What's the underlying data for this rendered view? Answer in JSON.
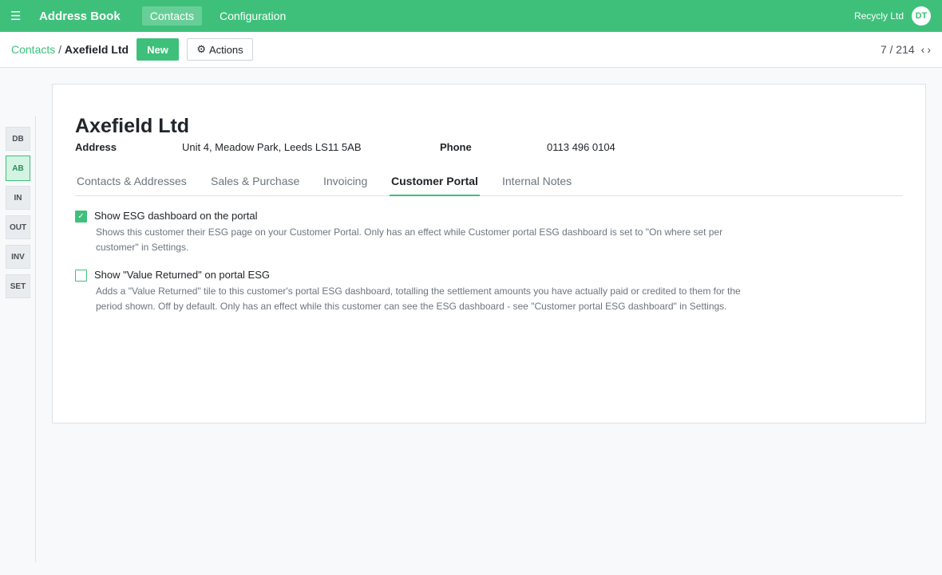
{
  "topbar": {
    "menu_icon": "☰",
    "app_title": "Address Book",
    "nav": [
      {
        "label": "Contacts"
      },
      {
        "label": "Configuration"
      }
    ],
    "company": "Recycly Ltd",
    "avatar_initials": "DT"
  },
  "control": {
    "breadcrumb_parent": "Contacts",
    "breadcrumb_sep": "/",
    "breadcrumb_current": "Axefield Ltd",
    "new_label": "New",
    "actions_icon": "⚙",
    "actions_label": "Actions",
    "pager": "7 / 214",
    "pager_prev": "‹",
    "pager_next": "›"
  },
  "siderail": [
    {
      "label": "DB"
    },
    {
      "label": "AB",
      "active": true
    },
    {
      "label": "IN"
    },
    {
      "label": "OUT"
    },
    {
      "label": "INV"
    },
    {
      "label": "SET"
    }
  ],
  "record": {
    "name": "Axefield Ltd",
    "address_label": "Address",
    "address_value": "Unit 4, Meadow Park, Leeds LS11 5AB",
    "phone_label": "Phone",
    "phone_value": "0113 496 0104"
  },
  "tabs": [
    {
      "label": "Contacts & Addresses"
    },
    {
      "label": "Sales & Purchase"
    },
    {
      "label": "Invoicing"
    },
    {
      "label": "Customer Portal",
      "active": true
    },
    {
      "label": "Internal Notes"
    }
  ],
  "options": [
    {
      "checked": true,
      "check_mark": "✓",
      "label": "Show ESG dashboard on the portal",
      "help": "Shows this customer their ESG page on your Customer Portal. Only has an effect while Customer portal ESG dashboard is set to \"On where set per customer\" in Settings."
    },
    {
      "checked": false,
      "check_mark": "",
      "label": "Show \"Value Returned\" on portal ESG",
      "help": "Adds a \"Value Returned\" tile to this customer's portal ESG dashboard, totalling the settlement amounts you have actually paid or credited to them for the period shown. Off by default. Only has an effect while this customer can see the ESG dashboard - see \"Customer portal ESG dashboard\" in Settings."
    }
  ],
  "colors": {
    "brand": "#3ec07b",
    "muted_text": "#6c757d"
  }
}
